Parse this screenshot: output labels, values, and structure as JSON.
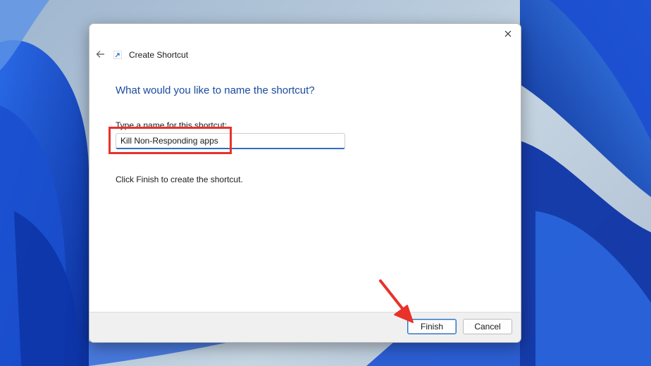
{
  "colors": {
    "heading": "#1a4aa0",
    "accent": "#2f6fc0",
    "annotation": "#e8322a",
    "wallpaper": "#1e56d6"
  },
  "dialog": {
    "title": "Create Shortcut",
    "title_icon": "shortcut-icon",
    "heading": "What would you like to name the shortcut?",
    "field_label": "Type a name for this shortcut:",
    "name_value": "Kill Non-Responding apps",
    "hint": "Click Finish to create the shortcut.",
    "buttons": {
      "finish": "Finish",
      "cancel": "Cancel"
    }
  },
  "icons": {
    "close": "close-icon",
    "back": "back-arrow-icon"
  }
}
